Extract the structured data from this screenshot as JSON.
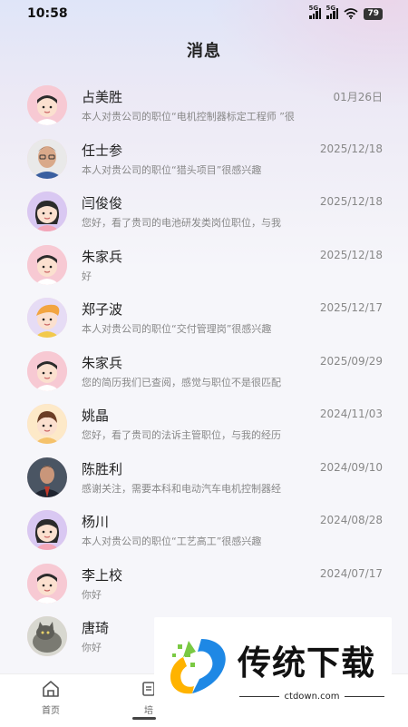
{
  "status_bar": {
    "time": "10:58",
    "signal_1": "5G",
    "signal_2": "5G",
    "battery": "79"
  },
  "header": {
    "title": "消息"
  },
  "messages": [
    {
      "name": "占美胜",
      "date": "01月26日",
      "preview": "本人对贵公司的职位“电机控制器标定工程师 ”很",
      "avatar": "cartoon-man-pink"
    },
    {
      "name": "任士参",
      "date": "2025/12/18",
      "preview": "本人对贵公司的职位“猎头项目”很感兴趣",
      "avatar": "photo-man-glasses"
    },
    {
      "name": "闫俊俊",
      "date": "2025/12/18",
      "preview": "您好，看了贵司的电池研发类岗位职位，与我",
      "avatar": "cartoon-woman-purple"
    },
    {
      "name": "朱家兵",
      "date": "2025/12/18",
      "preview": "好",
      "avatar": "cartoon-man-pink"
    },
    {
      "name": "郑子波",
      "date": "2025/12/17",
      "preview": "本人对贵公司的职位“交付管理岗”很感兴趣",
      "avatar": "cartoon-girl-yellow-hair"
    },
    {
      "name": "朱家兵",
      "date": "2025/09/29",
      "preview": "您的简历我们已查阅，感觉与职位不是很匹配",
      "avatar": "cartoon-man-pink"
    },
    {
      "name": "姚晶",
      "date": "2024/11/03",
      "preview": "您好，看了贵司的法诉主管职位，与我的经历",
      "avatar": "cartoon-boy-yellow"
    },
    {
      "name": "陈胜利",
      "date": "2024/09/10",
      "preview": "感谢关注，需要本科和电动汽车电机控制器经",
      "avatar": "photo-man-suit"
    },
    {
      "name": "杨川",
      "date": "2024/08/28",
      "preview": "本人对贵公司的职位“工艺高工”很感兴趣",
      "avatar": "cartoon-woman-purple"
    },
    {
      "name": "李上校",
      "date": "2024/07/17",
      "preview": "你好",
      "avatar": "cartoon-man-pink"
    },
    {
      "name": "唐琦",
      "date": "",
      "preview": "你好",
      "avatar": "photo-cat"
    }
  ],
  "tabbar": {
    "home_label": "首页",
    "training_label": "培"
  },
  "watermark": {
    "brand": "传统下载",
    "url": "ctdown.com"
  },
  "colors": {
    "background": "#f6f6fa",
    "avatar_pink": "#f7c9d3",
    "avatar_purple": "#d9c8f2",
    "accent_blue": "#1e88e5",
    "accent_green": "#7ac943"
  }
}
